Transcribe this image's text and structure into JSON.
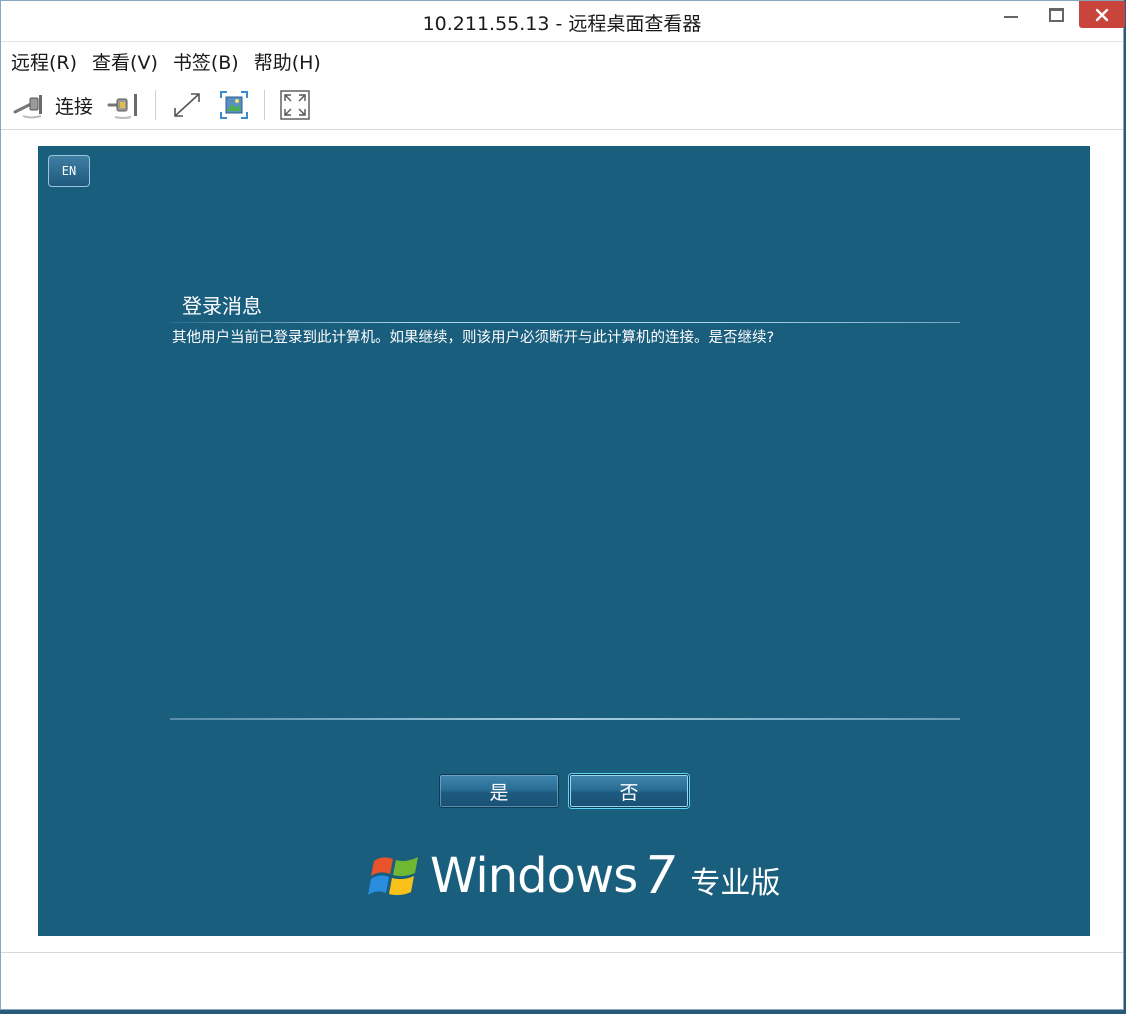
{
  "window": {
    "title": "10.211.55.13 - 远程桌面查看器"
  },
  "menu": {
    "items": [
      "远程(R)",
      "查看(V)",
      "书签(B)",
      "帮助(H)"
    ]
  },
  "toolbar": {
    "connect_label": "连接",
    "icons": [
      "connect-plug-icon",
      "disconnect-plug-icon",
      "resize-icon",
      "screenshot-icon",
      "fullscreen-icon"
    ]
  },
  "remote": {
    "lang_button": "EN",
    "dialog": {
      "title": "登录消息",
      "message": "其他用户当前已登录到此计算机。如果继续，则该用户必须断开与此计算机的连接。是否继续?",
      "yes_label": "是",
      "no_label": "否"
    },
    "brand": {
      "word": "Windows",
      "version": "7",
      "edition": "专业版"
    },
    "colors": {
      "background": "#1a5e7e",
      "close_button": "#c9443a"
    }
  }
}
